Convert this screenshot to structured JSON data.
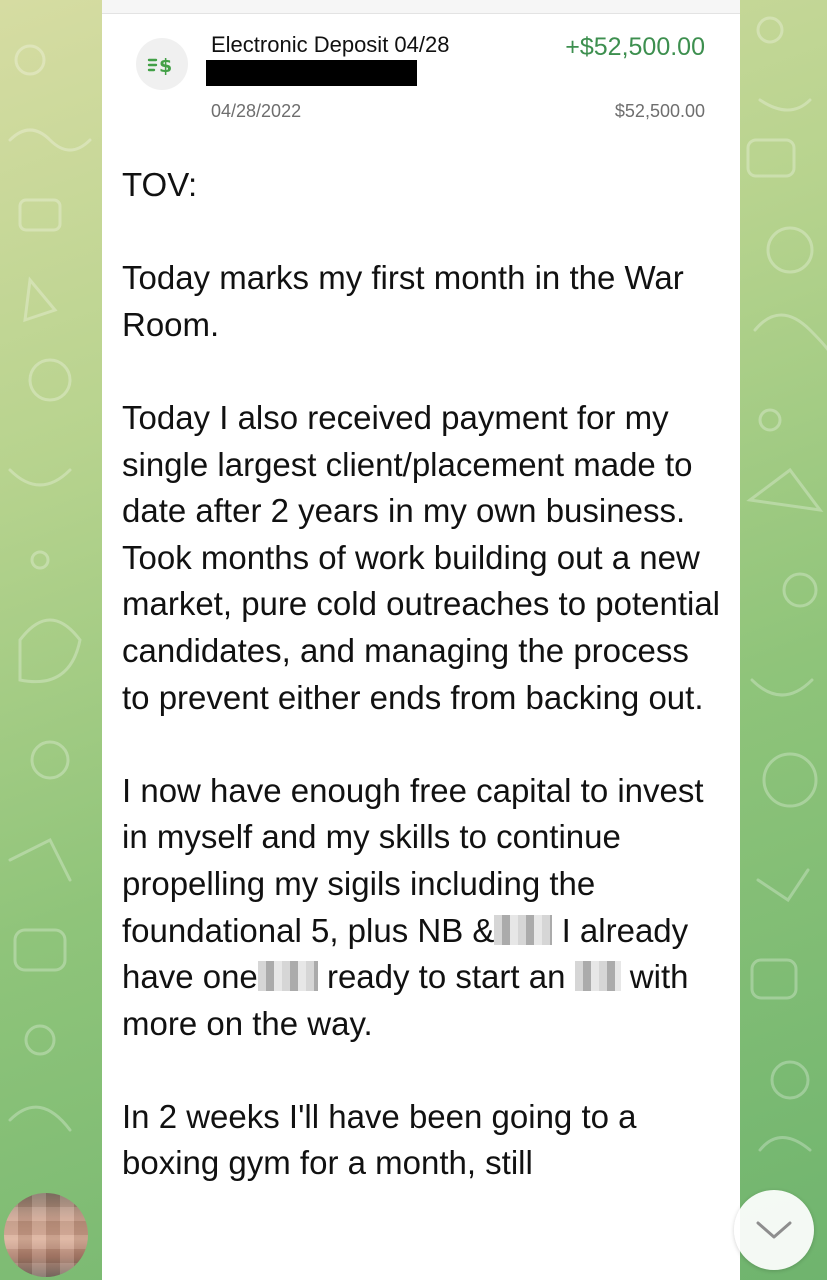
{
  "transaction": {
    "icon": "dollar-transfer-icon",
    "title": "Electronic Deposit 04/28",
    "amount": "+$52,500.00",
    "date": "04/28/2022",
    "balance": "$52,500.00",
    "amount_color": "#3d8f4f"
  },
  "message": {
    "p1": "TOV:",
    "p2": "Today marks my first month in the War Room.",
    "p3": "Today I also received payment for my single largest client/placement made to date after 2 years in my own business. Took months of work building out a new market, pure cold outreaches to potential candidates, and managing the process to prevent either ends from backing out.",
    "p4_a": "I now have enough free capital to invest in myself and my skills to continue propelling my sigils including the foundational 5, plus NB &",
    "p4_b": " I already have one",
    "p4_c": " ready to start an",
    "p4_d": " with more on the way.",
    "p5": "In 2 weeks I'll have been going to a boxing gym for a month, still"
  },
  "colors": {
    "wallpaper_start": "#d6dca2",
    "wallpaper_end": "#6fb46e",
    "bubble": "#ffffff"
  },
  "icons": {
    "scroll_down": "chevron-down-icon",
    "avatar": "user-avatar"
  }
}
